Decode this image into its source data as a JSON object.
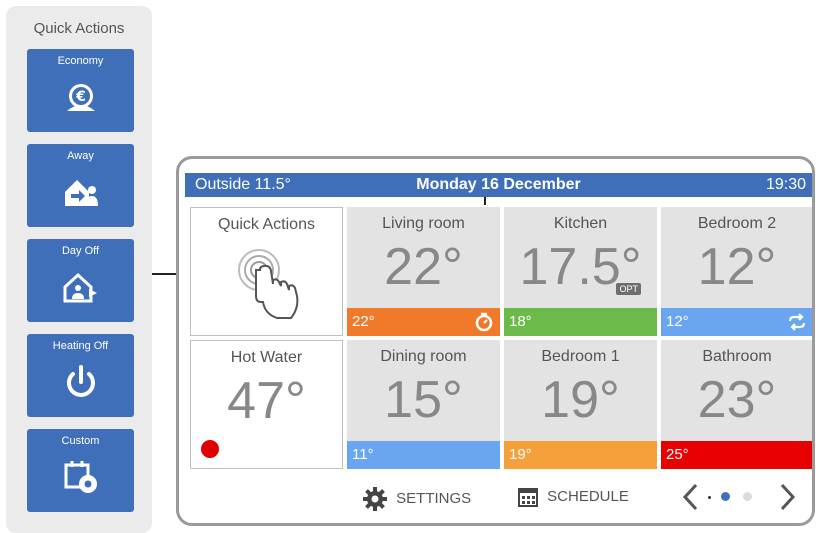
{
  "quick_actions_panel": {
    "title": "Quick Actions",
    "buttons": [
      {
        "label": "Economy",
        "icon": "euro-piggy-icon"
      },
      {
        "label": "Away",
        "icon": "house-away-icon"
      },
      {
        "label": "Day Off",
        "icon": "house-day-off-icon"
      },
      {
        "label": "Heating Off",
        "icon": "power-icon"
      },
      {
        "label": "Custom",
        "icon": "calendar-gear-icon"
      }
    ]
  },
  "screen": {
    "outside": "Outside 11.5°",
    "date": "Monday 16 December",
    "time": "19:30",
    "quick_actions_tile": "Quick Actions",
    "hot_water": {
      "name": "Hot Water",
      "temp": "47°",
      "status_color": "#e00000"
    },
    "rooms": [
      {
        "name": "Living room",
        "temp": "22°",
        "setpoint": "22°",
        "bar_color": "#f07a2a",
        "bar_icon": "timer-icon"
      },
      {
        "name": "Kitchen",
        "temp": "17.5°",
        "setpoint": "18°",
        "bar_color": "#6cbb4a",
        "badge": "OPT"
      },
      {
        "name": "Bedroom 2",
        "temp": "12°",
        "setpoint": "12°",
        "bar_color": "#6aa6f0",
        "bar_icon": "repeat-icon"
      },
      {
        "name": "Dining room",
        "temp": "15°",
        "setpoint": "11°",
        "bar_color": "#6aa6f0"
      },
      {
        "name": "Bedroom 1",
        "temp": "19°",
        "setpoint": "19°",
        "bar_color": "#f5a03a"
      },
      {
        "name": "Bathroom",
        "temp": "23°",
        "setpoint": "25°",
        "bar_color": "#e60000"
      }
    ],
    "footer": {
      "settings": "SETTINGS",
      "schedule": "SCHEDULE"
    },
    "pager": {
      "current_page": 2,
      "total_pages": 3
    }
  },
  "colors": {
    "accent": "#3f6fb8",
    "panel_bg": "#ebebeb",
    "tile_bg": "#e3e3e3"
  }
}
